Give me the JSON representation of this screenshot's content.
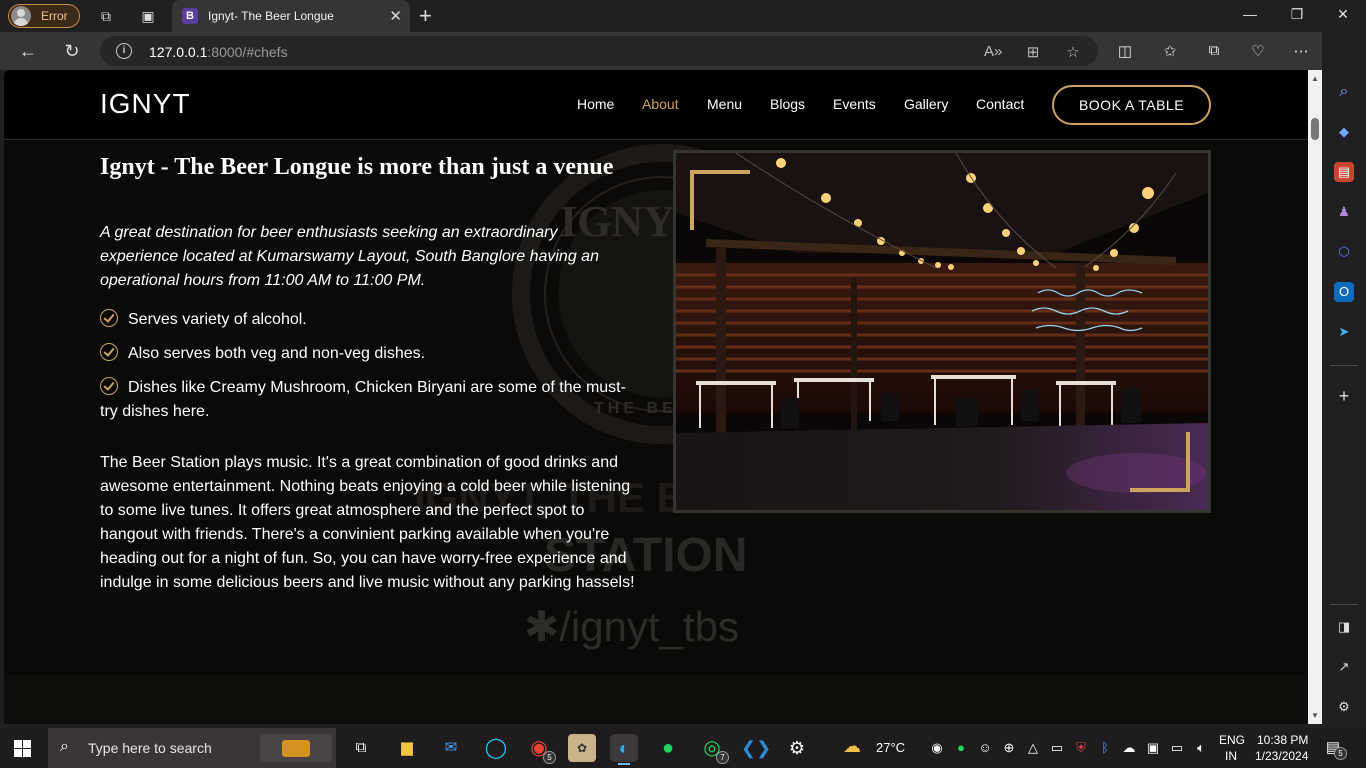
{
  "browser": {
    "profile_label": "Error",
    "tab_title": "Ignyt- The Beer Longue",
    "tab_favicon": "B",
    "url_host": "127.0.0.1",
    "url_rest": ":8000/#chefs"
  },
  "site": {
    "logo": "IGNYT",
    "nav": [
      "Home",
      "About",
      "Menu",
      "Blogs",
      "Events",
      "Gallery",
      "Contact"
    ],
    "active_nav": "About",
    "book_button": "BOOK A TABLE",
    "accent_color": "#cda45e"
  },
  "about": {
    "title": "Ignyt - The Beer Longue is more than just a venue",
    "lead": "A great destination for beer enthusiasts seeking an extraordinary experience located at Kumarswamy Layout, South Banglore having an operational hours from 11:00 AM to 11:00 PM.",
    "features": [
      "Serves variety of alcohol.",
      "Also serves both veg and non-veg dishes.",
      "Dishes like Creamy Mushroom, Chicken Biryani are some of the must-try dishes here."
    ],
    "body": "The Beer Station plays music. It's a great combination of good drinks and awesome entertainment. Nothing beats enjoying a cold beer while listening to some live tunes. It offers great atmosphere and the perfect spot to hangout with friends. There's a convinient parking available when you're heading out for a night of fun. So, you can have worry-free experience and indulge in some delicious beers and live music without any parking hassels!",
    "watermark": {
      "logo_text": "IGNY",
      "ring_text": "THE BEER",
      "big_text_1": "IGNYT, THE BEER",
      "big_text_2": "STATION",
      "handle": "/ignyt_tbs"
    },
    "neon_sign": "The Perfect Blend of Beer & Good Vibes"
  },
  "taskbar": {
    "search_placeholder": "Type here to search",
    "weather": "27°C",
    "lang_1": "ENG",
    "lang_2": "IN",
    "time": "10:38 PM",
    "date": "1/23/2024",
    "notifications": "5",
    "chrome_badge": "5",
    "whatsapp_badge": "7"
  }
}
